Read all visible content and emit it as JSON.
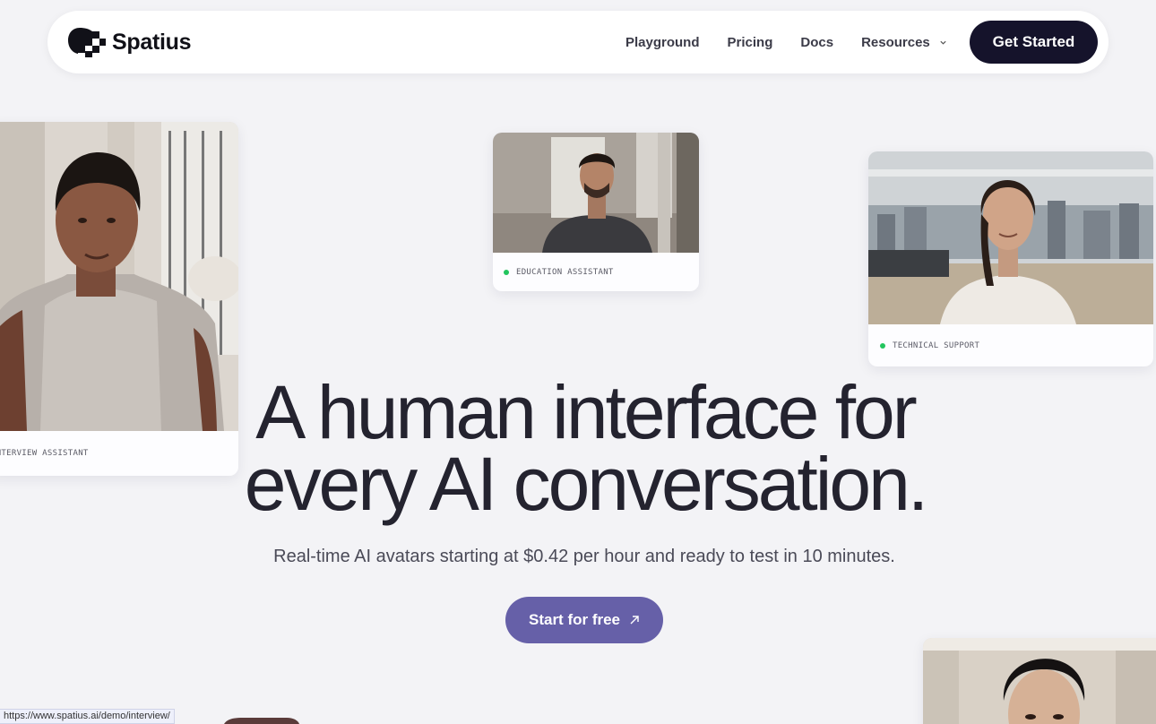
{
  "brand": {
    "name": "Spatius"
  },
  "nav": {
    "links": [
      "Playground",
      "Pricing",
      "Docs",
      "Resources"
    ],
    "cta": "Get Started"
  },
  "cards": {
    "interview": "INTERVIEW ASSISTANT",
    "education": "EDUCATION ASSISTANT",
    "support": "TECHNICAL SUPPORT"
  },
  "hero": {
    "headline_line1": "A human interface for",
    "headline_line2": "every AI conversation.",
    "subtitle": "Real-time AI avatars starting at $0.42 per hour and ready to test in 10 minutes.",
    "cta": "Start for free"
  },
  "status_bar": {
    "url": "https://www.spatius.ai/demo/interview/"
  },
  "colors": {
    "cta_dark": "#15132b",
    "accent": "#6660a8",
    "status_dot": "#23c55e"
  }
}
